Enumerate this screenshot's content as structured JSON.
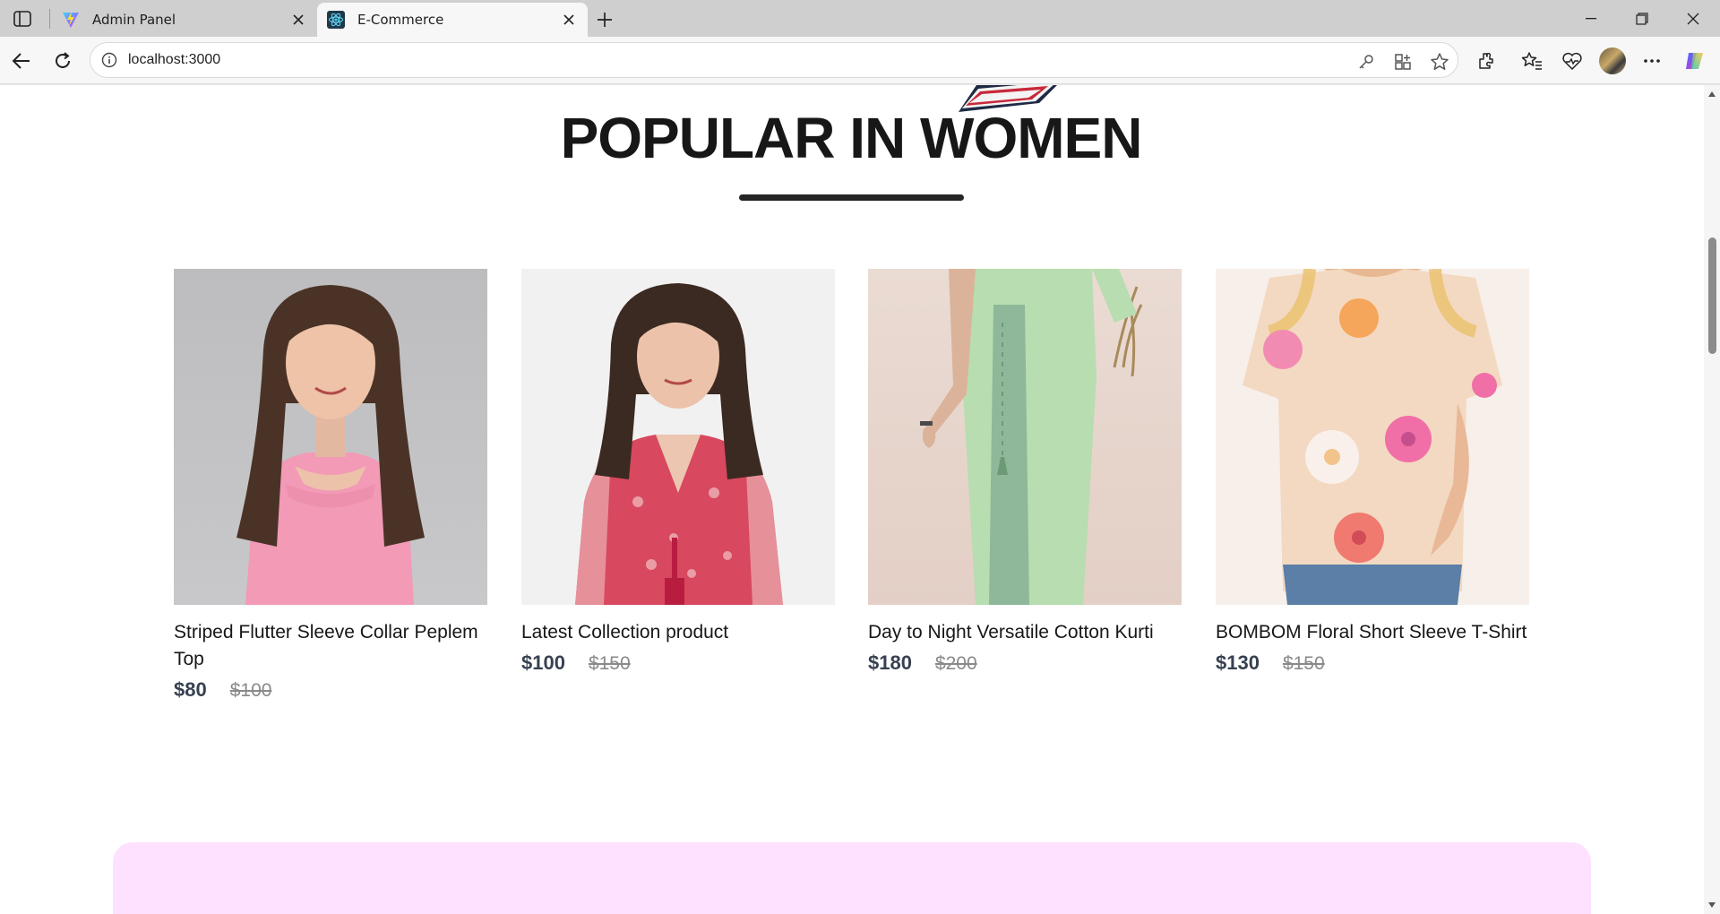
{
  "browser": {
    "tabs": [
      {
        "title": "Admin Panel",
        "active": false,
        "favicon": "vite-logo-icon"
      },
      {
        "title": "E-Commerce",
        "active": true,
        "favicon": "react-logo-icon"
      }
    ],
    "address": "localhost:3000"
  },
  "section": {
    "title": "POPULAR IN WOMEN"
  },
  "products": [
    {
      "name": "Striped Flutter Sleeve Collar Peplem Top",
      "new_price": "$80",
      "old_price": "$100"
    },
    {
      "name": "Latest Collection product",
      "new_price": "$100",
      "old_price": "$150"
    },
    {
      "name": "Day to Night Versatile Cotton Kurti",
      "new_price": "$180",
      "old_price": "$200"
    },
    {
      "name": "BOMBOM Floral Short Sleeve T-Shirt",
      "new_price": "$130",
      "old_price": "$150"
    }
  ],
  "colors": {
    "banner": "#fde1ff",
    "heading": "#171717",
    "price": "#374151",
    "old_price": "#8a8a8a"
  }
}
